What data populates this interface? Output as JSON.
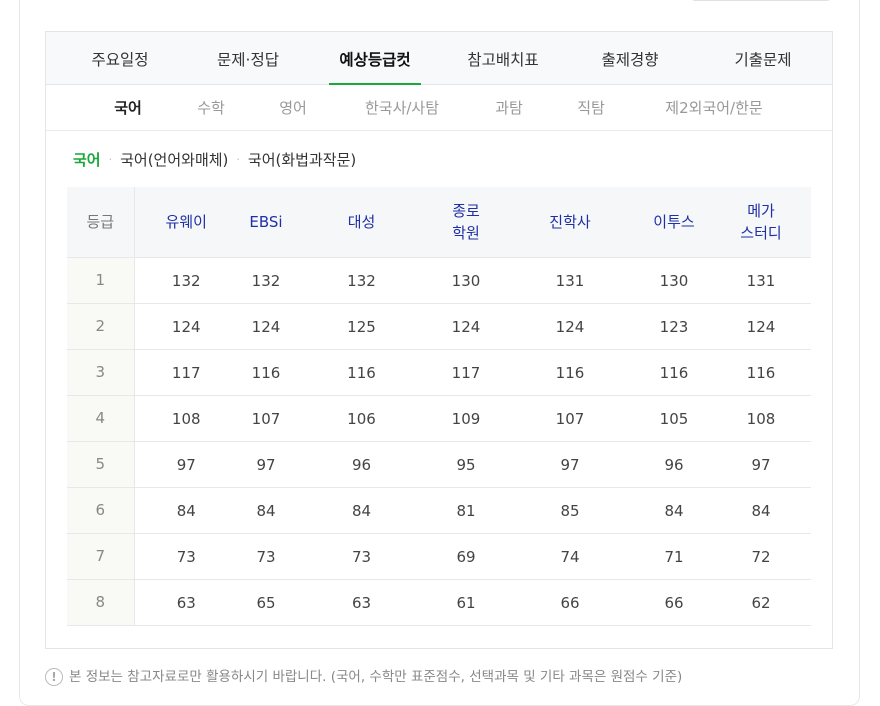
{
  "main_tabs": [
    "주요일정",
    "문제·정답",
    "예상등급컷",
    "참고배치표",
    "출제경향",
    "기출문제"
  ],
  "sub_tabs": [
    "국어",
    "수학",
    "영어",
    "한국사/사탐",
    "과탐",
    "직탐",
    "제2외국어/한문"
  ],
  "subject_filter": [
    "국어",
    "국어(언어와매체)",
    "국어(화법과작문)"
  ],
  "table": {
    "grade_header": "등급",
    "providers": [
      "유웨이",
      "EBSi",
      "대성",
      "종로\n학원",
      "진학사",
      "이투스",
      "메가\n스터디"
    ],
    "rows": [
      {
        "grade": "1",
        "values": [
          "132",
          "132",
          "132",
          "130",
          "131",
          "130",
          "131"
        ]
      },
      {
        "grade": "2",
        "values": [
          "124",
          "124",
          "125",
          "124",
          "124",
          "123",
          "124"
        ]
      },
      {
        "grade": "3",
        "values": [
          "117",
          "116",
          "116",
          "117",
          "116",
          "116",
          "116"
        ]
      },
      {
        "grade": "4",
        "values": [
          "108",
          "107",
          "106",
          "109",
          "107",
          "105",
          "108"
        ]
      },
      {
        "grade": "5",
        "values": [
          "97",
          "97",
          "96",
          "95",
          "97",
          "96",
          "97"
        ]
      },
      {
        "grade": "6",
        "values": [
          "84",
          "84",
          "84",
          "81",
          "85",
          "84",
          "84"
        ]
      },
      {
        "grade": "7",
        "values": [
          "73",
          "73",
          "73",
          "69",
          "74",
          "71",
          "72"
        ]
      },
      {
        "grade": "8",
        "values": [
          "63",
          "65",
          "63",
          "61",
          "66",
          "66",
          "62"
        ]
      }
    ]
  },
  "notice": {
    "icon": "exclamation-icon",
    "icon_glyph": "!",
    "text": "본 정보는 참고자료로만 활용하시기 바랍니다. (국어, 수학만 표준점수, 선택과목 및 기타 과목은 원점수 기준)"
  },
  "colors": {
    "accent": "#1aa83b",
    "provider_header": "#1f2fa8"
  }
}
